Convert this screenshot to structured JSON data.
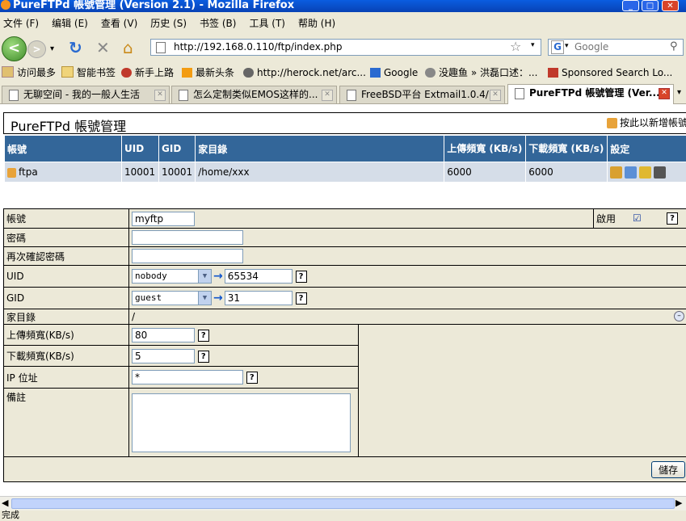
{
  "window": {
    "title": "PureFTPd 帳號管理 (Version 2.1) - Mozilla Firefox"
  },
  "menu": [
    "文件 (F)",
    "编辑 (E)",
    "查看 (V)",
    "历史 (S)",
    "书签 (B)",
    "工具 (T)",
    "帮助 (H)"
  ],
  "navbar": {
    "url": "http://192.168.0.110/ftp/index.php",
    "search_placeholder": "Google"
  },
  "bookmarks": [
    "访问最多",
    "智能书签",
    "新手上路",
    "最新头条",
    "http://herock.net/arc...",
    "Google",
    "没趣鱼 » 洪磊口述：...",
    "Sponsored Search Lo..."
  ],
  "tabs": [
    "无聊空间 - 我的一般人生活",
    "怎么定制类似EMOS这样的...",
    "FreeBSD平台 Extmail1.0.4/...",
    "PureFTPd 帳號管理 (Ver..."
  ],
  "page": {
    "title": "PureFTPd 帳號管理",
    "add_link": "按此以新增帳號",
    "table": {
      "headers": [
        "帳號",
        "UID",
        "GID",
        "家目錄",
        "上傳頻寬 (KB/s)",
        "下載頻寬 (KB/s)",
        "設定"
      ],
      "rows": [
        {
          "account": "ftpa",
          "uid": "10001",
          "gid": "10001",
          "home": "/home/xxx",
          "upload": "6000",
          "download": "6000"
        }
      ]
    },
    "form": {
      "account_label": "帳號",
      "account_value": "myftp",
      "enable_label": "啟用",
      "enable_checked": true,
      "password_label": "密碼",
      "confirm_label": "再次確認密碼",
      "uid_label": "UID",
      "uid_select": "nobody",
      "uid_value": "65534",
      "gid_label": "GID",
      "gid_select": "guest",
      "gid_value": "31",
      "home_label": "家目錄",
      "home_value": "/",
      "upload_label": "上傳頻寬(KB/s)",
      "upload_value": "80",
      "download_label": "下載頻寬(KB/s)",
      "download_value": "5",
      "ip_label": "IP 位址",
      "ip_value": "*",
      "note_label": "備註",
      "save_label": "儲存"
    }
  },
  "status": "完成"
}
